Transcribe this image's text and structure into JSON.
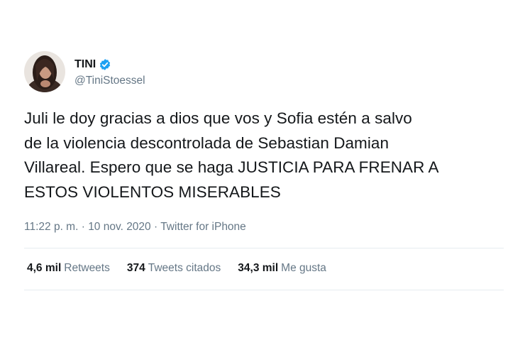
{
  "author": {
    "display_name": "TINI",
    "handle": "@TiniStoessel",
    "verified": true,
    "verified_badge_color": "#1da1f2"
  },
  "tweet": {
    "lines": [
      "Juli le doy gracias a dios que vos y Sofia estén a salvo",
      "de la violencia descontrolada de Sebastian Damian",
      "Villareal. Espero que se haga JUSTICIA PARA FRENAR A",
      "ESTOS VIOLENTOS MISERABLES"
    ]
  },
  "meta": {
    "time": "11:22 p. m.",
    "separator": "·",
    "date": "10 nov. 2020",
    "source": "Twitter for iPhone"
  },
  "stats": {
    "retweets_count": "4,6 mil",
    "retweets_label": "Retweets",
    "quotes_count": "374",
    "quotes_label": "Tweets citados",
    "likes_count": "34,3 mil",
    "likes_label": "Me gusta"
  },
  "colors": {
    "text": "#14171a",
    "secondary": "#657786",
    "divider": "#e6ecf0"
  }
}
